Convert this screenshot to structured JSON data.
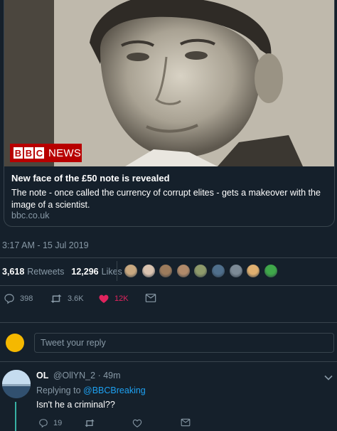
{
  "card": {
    "badge_logo": "BBC",
    "badge_word": "NEWS",
    "title": "New face of the £50 note is revealed",
    "description": "The note - once called the currency of corrupt elites - gets a makeover with the image of a scientist.",
    "domain": "bbc.co.uk"
  },
  "tweet": {
    "timestamp": "3:17 AM - 15 Jul 2019",
    "retweets": {
      "count": "3,618",
      "label": "Retweets"
    },
    "likes": {
      "count": "12,296",
      "label": "Likes"
    },
    "liker_avatars": [
      "#c8a880",
      "#d9c3b0",
      "#9c7b5c",
      "#b08a6a",
      "#8e9a6b",
      "#4f6f8c",
      "#7c8a96",
      "#e0b070",
      "#3fa84a"
    ],
    "actions": {
      "reply": {
        "label": "398",
        "icon": "reply-icon"
      },
      "retweet": {
        "label": "3.6K",
        "icon": "retweet-icon"
      },
      "like": {
        "label": "12K",
        "icon": "heart-icon"
      },
      "dm": {
        "icon": "envelope-icon"
      }
    }
  },
  "reply_box": {
    "placeholder": "Tweet your reply"
  },
  "reply": {
    "name": "OL",
    "handle": "@OllYN_2",
    "time": "· 49m",
    "replying_prefix": "Replying to",
    "replying_to": "@BBCBreaking",
    "text": "Isn't he a criminal??",
    "actions": {
      "reply": "19",
      "retweet": "",
      "like": ""
    }
  },
  "colors": {
    "background": "#15202b",
    "border": "#38444d",
    "muted": "#8899a6",
    "link": "#1da1f2",
    "like": "#e0245e",
    "bbc_red": "#b80000"
  }
}
